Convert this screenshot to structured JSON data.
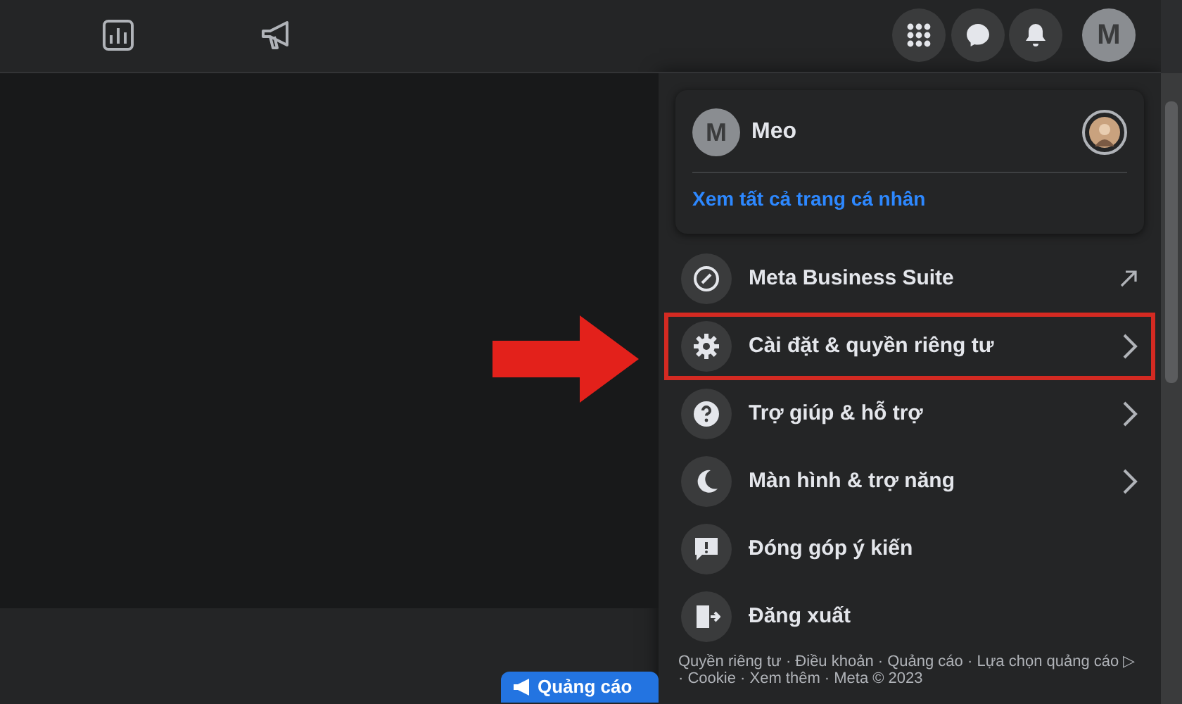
{
  "top_bar": {
    "account_initial": "M"
  },
  "profile": {
    "initial": "M",
    "name": "Meo",
    "link": "Xem tất cả trang cá nhân"
  },
  "menu_items": [
    {
      "kind": "business",
      "label": "Meta Business Suite",
      "external": true,
      "submenu": false,
      "highlighted": false
    },
    {
      "kind": "settings",
      "label": "Cài đặt & quyền riêng tư",
      "external": false,
      "submenu": true,
      "highlighted": true
    },
    {
      "kind": "help",
      "label": "Trợ giúp & hỗ trợ",
      "external": false,
      "submenu": true,
      "highlighted": false
    },
    {
      "kind": "display",
      "label": "Màn hình & trợ năng",
      "external": false,
      "submenu": true,
      "highlighted": false
    },
    {
      "kind": "feedback",
      "label": "Đóng góp ý kiến",
      "external": false,
      "submenu": false,
      "highlighted": false
    },
    {
      "kind": "logout",
      "label": "Đăng xuất",
      "external": false,
      "submenu": false,
      "highlighted": false
    }
  ],
  "footer": "Quyền riêng tư · Điều khoản · Quảng cáo · Lựa chọn quảng cáo ▷ · Cookie · Xem thêm · Meta © 2023",
  "ad_button": "Quảng cáo"
}
